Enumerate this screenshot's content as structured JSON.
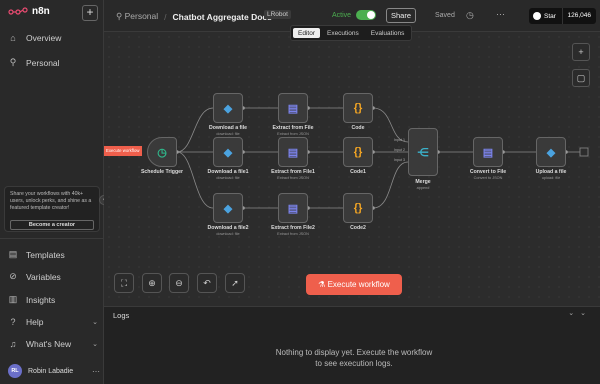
{
  "sidebar": {
    "brand": "n8n",
    "add_icon": "plus-icon",
    "items": [
      {
        "label": "Overview",
        "icon": "home-icon"
      },
      {
        "label": "Personal",
        "icon": "user-icon"
      }
    ],
    "promo_text": "Share your workflows with 40k+ users, unlock perks, and shine as a featured template creator!",
    "promo_button": "Become a creator",
    "bottom_items": [
      {
        "label": "Templates",
        "icon": "templates-icon"
      },
      {
        "label": "Variables",
        "icon": "variables-icon"
      },
      {
        "label": "Insights",
        "icon": "insights-icon"
      },
      {
        "label": "Help",
        "icon": "help-icon"
      },
      {
        "label": "What's New",
        "icon": "bell-icon"
      }
    ],
    "user": {
      "initials": "RL",
      "name": "Robin Labadie"
    }
  },
  "header": {
    "project": "Personal",
    "workflow_title": "Chatbot Aggregate Docs",
    "tag": "LRobot",
    "active_label": "Active",
    "share_label": "Share",
    "saved_label": "Saved",
    "github_label": "Star",
    "github_count": "126,046"
  },
  "tabs": [
    "Editor",
    "Executions",
    "Evaluations"
  ],
  "canvas": {
    "execute_tag": "Execute workflow",
    "nodes": {
      "trigger": {
        "label": "Schedule Trigger"
      },
      "d1": {
        "label": "Download a file",
        "sub": "download: file"
      },
      "d2": {
        "label": "Download a file1",
        "sub": "download: file"
      },
      "d3": {
        "label": "Download a file2",
        "sub": "download: file"
      },
      "e1": {
        "label": "Extract from File",
        "sub": "Extract from JSON"
      },
      "e2": {
        "label": "Extract from File1",
        "sub": "Extract from JSON"
      },
      "e3": {
        "label": "Extract from File2",
        "sub": "Extract from JSON"
      },
      "c1": {
        "label": "Code"
      },
      "c2": {
        "label": "Code1"
      },
      "c3": {
        "label": "Code2"
      },
      "merge": {
        "label": "Merge",
        "sub": "append",
        "inputs": [
          "Input 1",
          "Input 2",
          "Input 3"
        ]
      },
      "convert": {
        "label": "Convert to File",
        "sub": "Convert to JSON"
      },
      "upload": {
        "label": "Upload a file",
        "sub": "upload: file"
      }
    },
    "execute_button": "Execute workflow"
  },
  "logs": {
    "title": "Logs",
    "empty_message": "Nothing to display yet. Execute the workflow to see execution logs."
  }
}
